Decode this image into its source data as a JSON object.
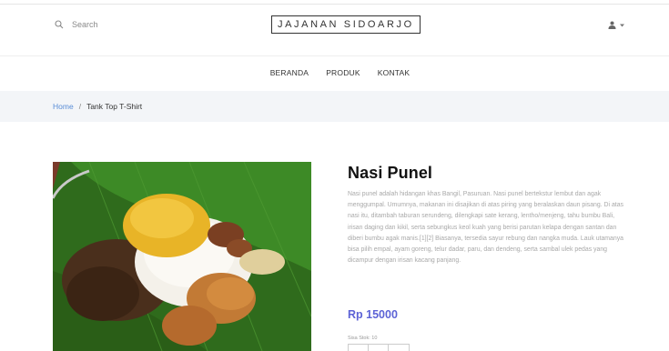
{
  "header": {
    "search_placeholder": "Search",
    "brand": "JAJANAN SIDOARJO"
  },
  "nav": {
    "items": [
      "BERANDA",
      "PRODUK",
      "KONTAK"
    ]
  },
  "breadcrumb": {
    "home": "Home",
    "separator": "/",
    "current": "Tank Top T-Shirt"
  },
  "product": {
    "name": "Nasi Punel",
    "description": "Nasi punel adalah hidangan khas Bangil, Pasuruan. Nasi punel bertekstur lembut dan agak menggumpal. Umumnya, makanan ini disajikan di atas piring yang beralaskan daun pisang. Di atas nasi itu, ditambah taburan serundeng, dilengkapi sate kerang, lentho/menjeng, tahu bumbu Bali, irisan daging dan kikil, serta sebungkus keol kuah yang berisi parutan kelapa dengan santan dan diberi bumbu agak manis.[1][2] Biasanya, tersedia sayur rebung dan nangka muda. Lauk utamanya bisa pilih empal, ayam goreng, telur dadar, paru, dan dendeng, serta sambal ulek pedas yang dicampur dengan irisan kacang panjang.",
    "price": "Rp 15000",
    "stock": "Sisa Stok: 10"
  },
  "colors": {
    "accent": "#5d63d6",
    "link": "#5a8dd6",
    "breadcrumb_bg": "#f3f5f8"
  },
  "icons": {
    "search": "search-icon",
    "user": "user-icon",
    "caret": "chevron-down-icon"
  }
}
